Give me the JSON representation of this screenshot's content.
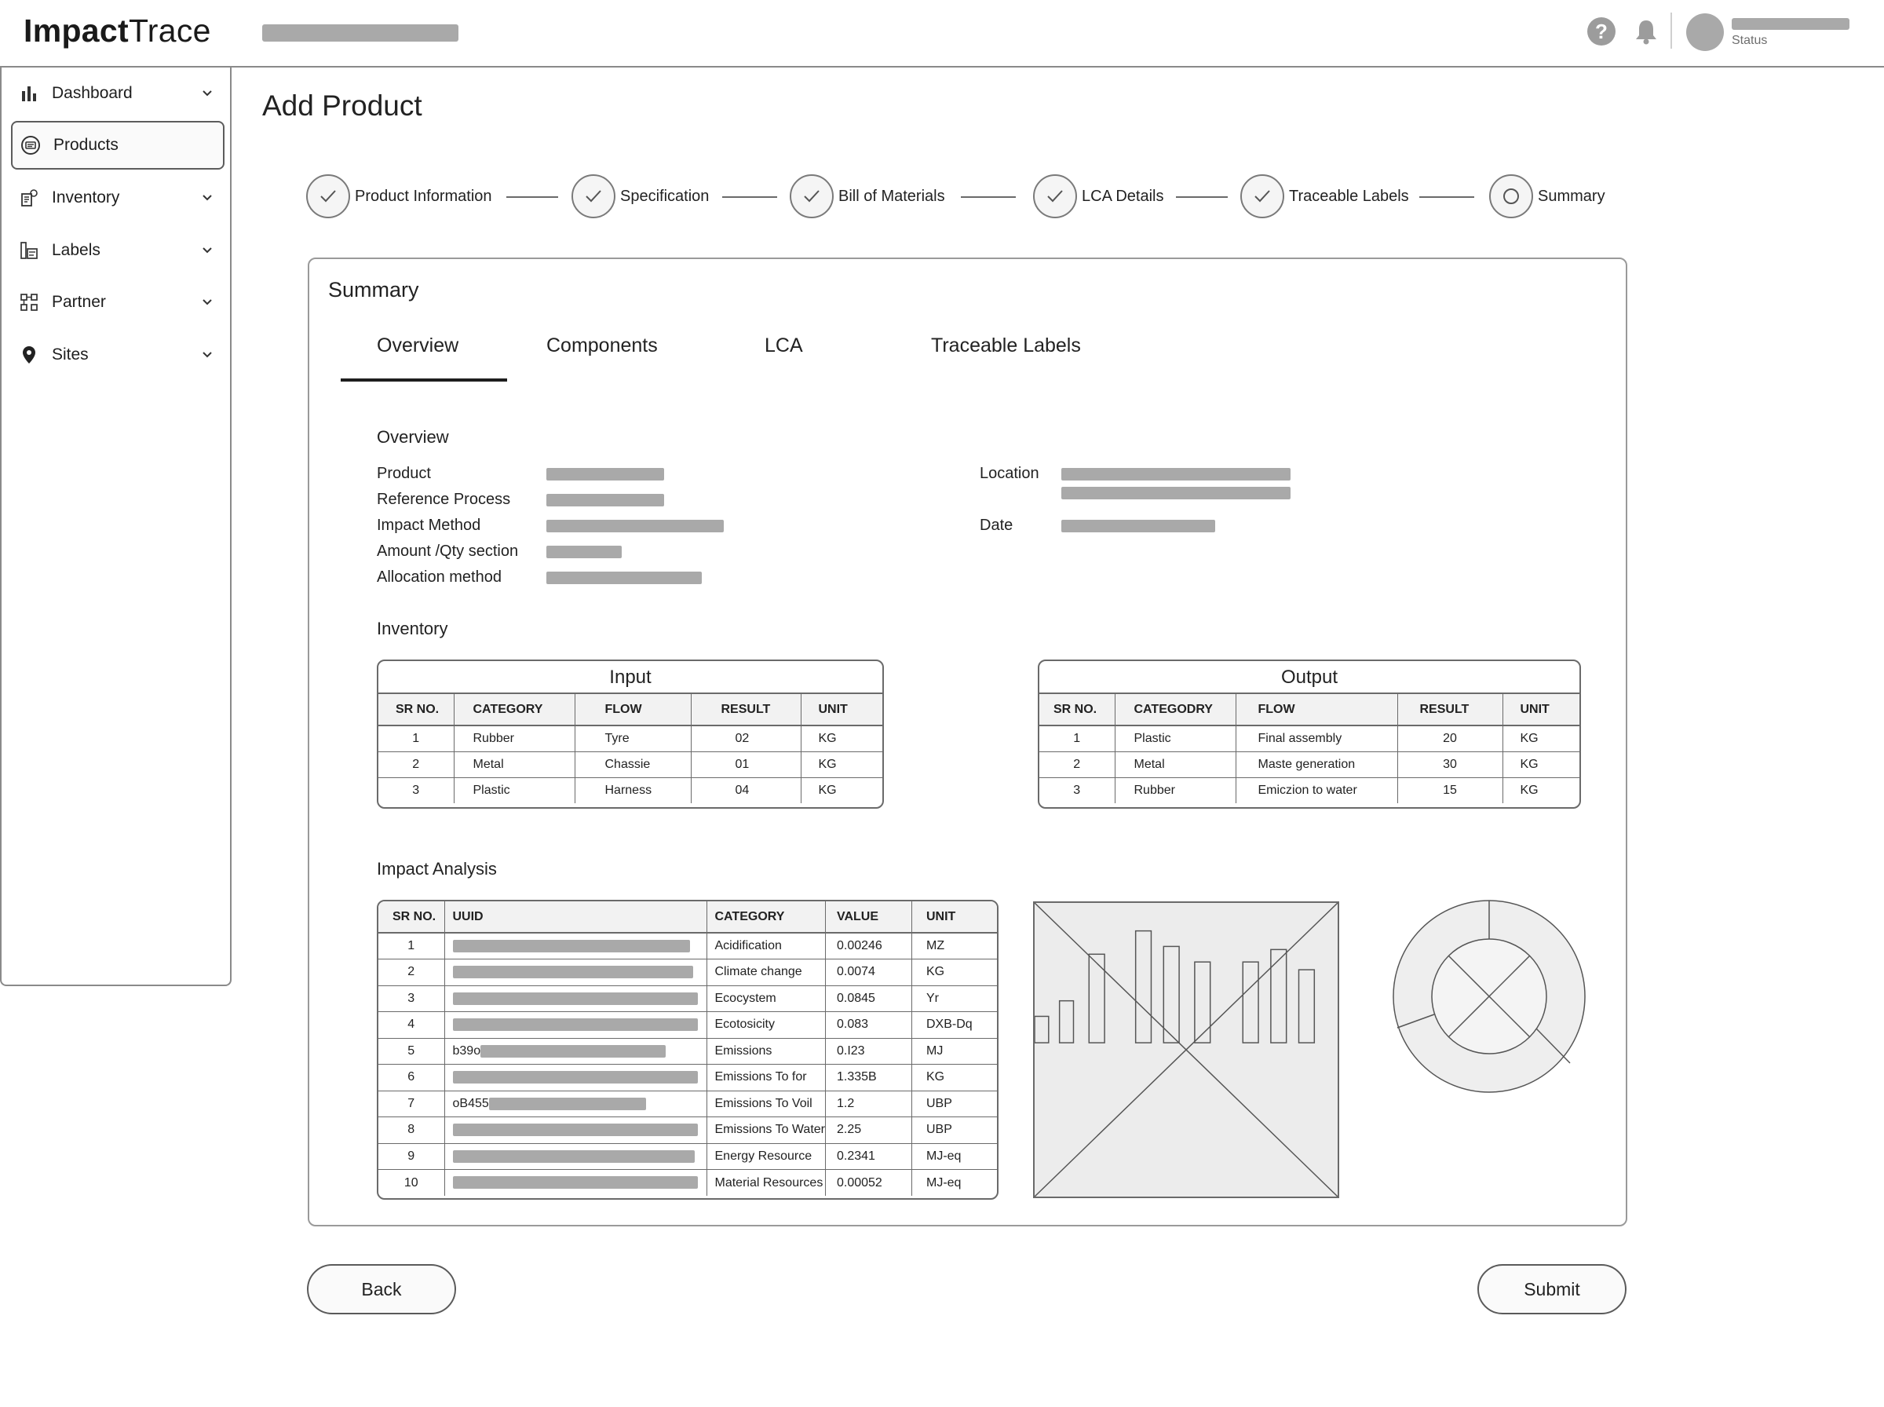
{
  "app": {
    "logo_bold": "Impact",
    "logo_light": "Trace"
  },
  "header": {
    "user_status": "Status"
  },
  "sidebar": {
    "items": [
      {
        "label": "Dashboard",
        "icon": "bar-chart-icon",
        "has_chevron": true,
        "active": false
      },
      {
        "label": "Products",
        "icon": "products-icon",
        "has_chevron": false,
        "active": true
      },
      {
        "label": "Inventory",
        "icon": "inventory-icon",
        "has_chevron": true,
        "active": false
      },
      {
        "label": "Labels",
        "icon": "labels-icon",
        "has_chevron": true,
        "active": false
      },
      {
        "label": "Partner",
        "icon": "partner-icon",
        "has_chevron": true,
        "active": false
      },
      {
        "label": "Sites",
        "icon": "location-pin-icon",
        "has_chevron": true,
        "active": false
      }
    ]
  },
  "page": {
    "title": "Add Product"
  },
  "stepper": {
    "steps": [
      {
        "label": "Product Information",
        "state": "complete"
      },
      {
        "label": "Specification",
        "state": "complete"
      },
      {
        "label": "Bill of Materials",
        "state": "complete"
      },
      {
        "label": "LCA Details",
        "state": "complete"
      },
      {
        "label": "Traceable Labels",
        "state": "complete"
      },
      {
        "label": "Summary",
        "state": "current"
      }
    ]
  },
  "summary": {
    "title": "Summary",
    "tabs": [
      "Overview",
      "Components",
      "LCA",
      "Traceable Labels"
    ],
    "active_tab": "Overview",
    "overview": {
      "title": "Overview",
      "fields_left": [
        "Product",
        "Reference Process",
        "Impact Method",
        "Amount /Qty section",
        "Allocation method"
      ],
      "fields_right": [
        "Location",
        "Date"
      ]
    },
    "inventory": {
      "title": "Inventory",
      "input": {
        "caption": "Input",
        "headers": [
          "SR NO.",
          "CATEGORY",
          "FLOW",
          "RESULT",
          "UNIT"
        ],
        "rows": [
          [
            "1",
            "Rubber",
            "Tyre",
            "02",
            "KG"
          ],
          [
            "2",
            "Metal",
            "Chassie",
            "01",
            "KG"
          ],
          [
            "3",
            "Plastic",
            "Harness",
            "04",
            "KG"
          ]
        ]
      },
      "output": {
        "caption": "Output",
        "headers": [
          "SR NO.",
          "CATEGODRY",
          "FLOW",
          "RESULT",
          "UNIT"
        ],
        "rows": [
          [
            "1",
            "Plastic",
            "Final assembly",
            "20",
            "KG"
          ],
          [
            "2",
            "Metal",
            "Maste generation",
            "30",
            "KG"
          ],
          [
            "3",
            "Rubber",
            "Emiczion to water",
            "15",
            "KG"
          ]
        ]
      }
    },
    "impact": {
      "title": "Impact Analysis",
      "headers": [
        "SR NO.",
        "UUID",
        "CATEGORY",
        "VALUE",
        "UNIT"
      ],
      "rows": [
        [
          "1",
          "",
          "Acidification",
          "0.00246",
          "MZ"
        ],
        [
          "2",
          "",
          "Climate change",
          "0.0074",
          "KG"
        ],
        [
          "3",
          "",
          "Ecocystem",
          "0.0845",
          "Yr"
        ],
        [
          "4",
          "",
          "Ecotosicity",
          "0.083",
          "DXB-Dq"
        ],
        [
          "5",
          "b39o",
          "Emissions",
          "0.I23",
          "MJ"
        ],
        [
          "6",
          "",
          "Emissions To for",
          "1.335B",
          "KG"
        ],
        [
          "7",
          "oB455",
          "Emissions To Voil",
          "1.2",
          "UBP"
        ],
        [
          "8",
          "",
          "Emissions To Water",
          "2.25",
          "UBP"
        ],
        [
          "9",
          "",
          "Energy Resource",
          "0.2341",
          "MJ-eq"
        ],
        [
          "10",
          "",
          "Material Resources",
          "0.00052",
          "MJ-eq"
        ]
      ]
    }
  },
  "actions": {
    "back": "Back",
    "submit": "Submit"
  }
}
